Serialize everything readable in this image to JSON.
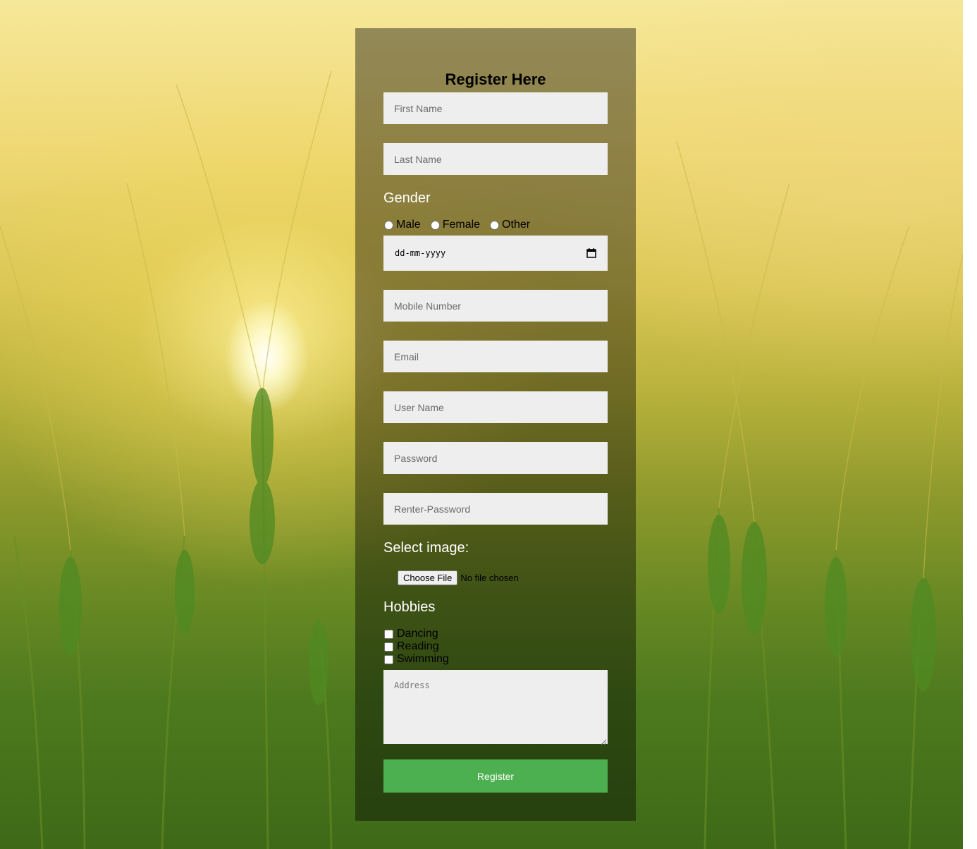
{
  "form": {
    "title": "Register Here",
    "first_name_placeholder": "First Name",
    "last_name_placeholder": "Last Name",
    "gender_label": "Gender",
    "gender_options": [
      "Male",
      "Female",
      "Other"
    ],
    "date_placeholder": "dd-mm-yyyy",
    "mobile_placeholder": "Mobile Number",
    "email_placeholder": "Email",
    "username_placeholder": "User Name",
    "password_placeholder": "Password",
    "reenter_password_placeholder": "Renter-Password",
    "image_label": "Select image:",
    "file_button_label": "Choose File",
    "file_status": "No file chosen",
    "hobbies_label": "Hobbies",
    "hobbies": [
      "Dancing",
      "Reading",
      "Swimming"
    ],
    "address_placeholder": "Address",
    "register_label": "Register"
  },
  "colors": {
    "register_button": "#4caf50",
    "input_background": "#eeeeee",
    "panel_overlay": "rgba(0,0,0,0.4)"
  },
  "icons": {
    "date_picker": "calendar-icon",
    "textarea_resize": "resize-handle-icon"
  }
}
